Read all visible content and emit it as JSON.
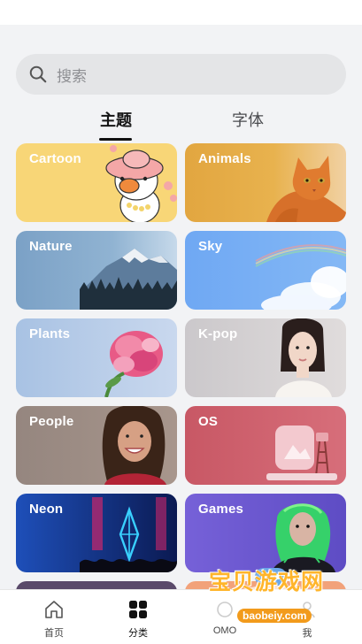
{
  "search": {
    "placeholder": "搜索"
  },
  "tabs": [
    {
      "label": "主题",
      "active": true
    },
    {
      "label": "字体",
      "active": false
    }
  ],
  "categories": [
    {
      "label": "Cartoon",
      "color": "#f8d677"
    },
    {
      "label": "Animals",
      "color": "#e2a640"
    },
    {
      "label": "Nature",
      "color": "#7ba1c6"
    },
    {
      "label": "Sky",
      "color": "#6fa8f3"
    },
    {
      "label": "Plants",
      "color": "#a8c2e3"
    },
    {
      "label": "K-pop",
      "color": "#cbc8cb"
    },
    {
      "label": "People",
      "color": "#95867f"
    },
    {
      "label": "OS",
      "color": "#c85865"
    },
    {
      "label": "Neon",
      "color": "#1e4fb9"
    },
    {
      "label": "Games",
      "color": "#7661d8"
    }
  ],
  "bottom_nav": [
    {
      "label": "首页",
      "icon": "home-icon"
    },
    {
      "label": "分类",
      "icon": "grid-icon",
      "active": true
    },
    {
      "label": "OMO",
      "icon": "omo-icon"
    },
    {
      "label": "我",
      "icon": "profile-icon"
    }
  ],
  "watermark": {
    "title": "宝贝游戏网",
    "url": "baobeiy.com"
  }
}
